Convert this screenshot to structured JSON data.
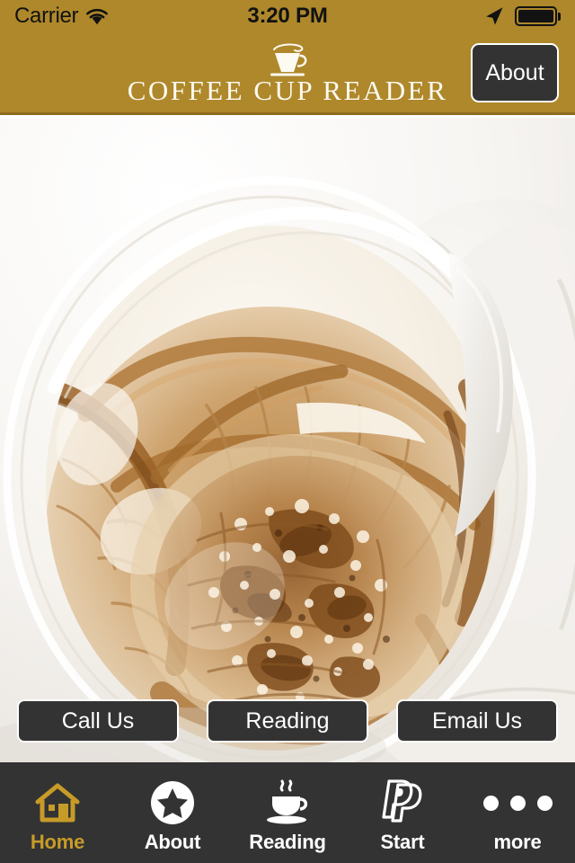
{
  "status_bar": {
    "carrier": "Carrier",
    "wifi_icon": "wifi-icon",
    "time": "3:20 PM",
    "location_icon": "location-arrow-icon",
    "battery_icon": "battery-full-icon"
  },
  "header": {
    "brand_title": "COFFEE CUP READER",
    "brand_icon": "coffee-cup-icon",
    "about_button": "About",
    "background_color": "#AE882B",
    "text_color": "#FDFAF2"
  },
  "hero": {
    "image_description": "coffee-cup-grounds-photo",
    "alt": "White coffee cup with brown coffee ground residue patterns inside, resting on a white saucer"
  },
  "actions": [
    {
      "label": "Call Us",
      "name": "call-us-button"
    },
    {
      "label": "Reading",
      "name": "reading-button"
    },
    {
      "label": "Email Us",
      "name": "email-us-button"
    }
  ],
  "tabbar": {
    "background_color": "#333333",
    "active_color": "#C79B28",
    "inactive_color": "#FFFFFF",
    "items": [
      {
        "label": "Home",
        "icon": "house-icon",
        "active": true
      },
      {
        "label": "About",
        "icon": "star-circle-icon",
        "active": false
      },
      {
        "label": "Reading",
        "icon": "coffee-cup-icon",
        "active": false
      },
      {
        "label": "Start",
        "icon": "paypal-p-icon",
        "active": false
      },
      {
        "label": "more",
        "icon": "three-dots-icon",
        "active": false
      }
    ]
  }
}
